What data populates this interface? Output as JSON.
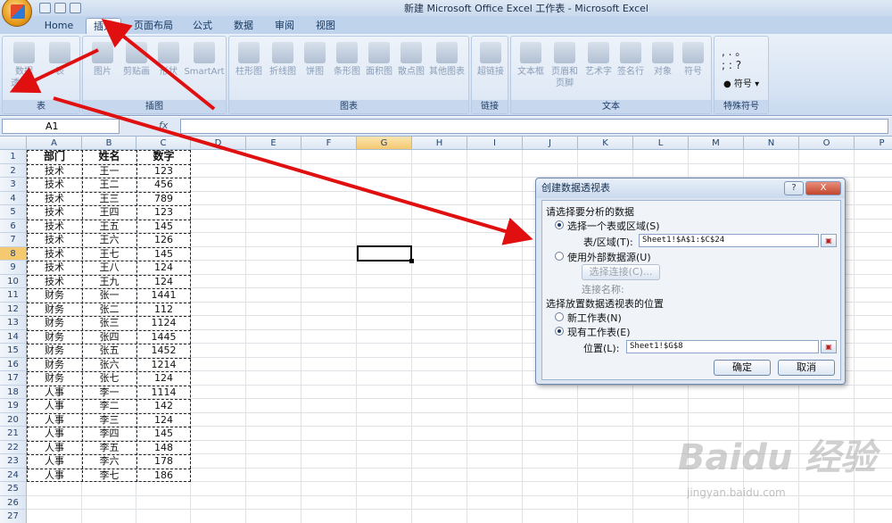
{
  "window": {
    "title": "新建 Microsoft Office Excel 工作表 - Microsoft Excel"
  },
  "tabs": [
    "Home",
    "插入",
    "页面布局",
    "公式",
    "数据",
    "审阅",
    "视图"
  ],
  "active_tab": "插入",
  "ribbon": {
    "groups": [
      "表",
      "插图",
      "图表",
      "链接",
      "文本",
      "特殊符号"
    ],
    "table": {
      "pivot1": "数据",
      "pivot2": "透视表",
      "table": "表"
    },
    "illus": [
      "图片",
      "剪贴画",
      "形状",
      "SmartArt"
    ],
    "charts": [
      "柱形图",
      "折线图",
      "饼图",
      "条形图",
      "面积图",
      "散点图",
      "其他图表"
    ],
    "links": [
      "超链接"
    ],
    "text": [
      "文本框",
      "页眉和\n页脚",
      "艺术字",
      "签名行",
      "对象",
      "符号"
    ],
    "special": {
      "symbols": "符号"
    }
  },
  "formula_bar": {
    "name_box": "A1",
    "fx": "fx",
    "content": ""
  },
  "columns": [
    "A",
    "B",
    "C",
    "D",
    "E",
    "F",
    "G",
    "H",
    "I",
    "J",
    "K",
    "L",
    "M",
    "N",
    "O",
    "P"
  ],
  "selected_col": "G",
  "selected_row": "8",
  "rows": [
    "1",
    "2",
    "3",
    "4",
    "5",
    "6",
    "7",
    "8",
    "9",
    "10",
    "11",
    "12",
    "13",
    "14",
    "15",
    "16",
    "17",
    "18",
    "19",
    "20",
    "21",
    "22",
    "23",
    "24",
    "25",
    "26",
    "27"
  ],
  "sheet": {
    "headers": [
      "部门",
      "姓名",
      "数字"
    ],
    "data": [
      [
        "技术",
        "王一",
        "123"
      ],
      [
        "技术",
        "王二",
        "456"
      ],
      [
        "技术",
        "王三",
        "789"
      ],
      [
        "技术",
        "王四",
        "123"
      ],
      [
        "技术",
        "王五",
        "145"
      ],
      [
        "技术",
        "王六",
        "126"
      ],
      [
        "技术",
        "王七",
        "145"
      ],
      [
        "技术",
        "王八",
        "124"
      ],
      [
        "技术",
        "王九",
        "124"
      ],
      [
        "财务",
        "张一",
        "1441"
      ],
      [
        "财务",
        "张二",
        "112"
      ],
      [
        "财务",
        "张三",
        "1124"
      ],
      [
        "财务",
        "张四",
        "1445"
      ],
      [
        "财务",
        "张五",
        "1452"
      ],
      [
        "财务",
        "张六",
        "1214"
      ],
      [
        "财务",
        "张七",
        "124"
      ],
      [
        "人事",
        "李一",
        "1114"
      ],
      [
        "人事",
        "李二",
        "142"
      ],
      [
        "人事",
        "李三",
        "124"
      ],
      [
        "人事",
        "李四",
        "145"
      ],
      [
        "人事",
        "李五",
        "148"
      ],
      [
        "人事",
        "李六",
        "178"
      ],
      [
        "人事",
        "李七",
        "186"
      ]
    ]
  },
  "dialog": {
    "title": "创建数据透视表",
    "help": "?",
    "close": "X",
    "section1": "请选择要分析的数据",
    "opt_select": "选择一个表或区域(S)",
    "range_label": "表/区域(T):",
    "range_value": "Sheet1!$A$1:$C$24",
    "opt_external": "使用外部数据源(U)",
    "choose_conn": "选择连接(C)...",
    "conn_name": "连接名称:",
    "section2": "选择放置数据透视表的位置",
    "opt_new": "新工作表(N)",
    "opt_existing": "现有工作表(E)",
    "location_label": "位置(L):",
    "location_value": "Sheet1!$G$8",
    "ok": "确定",
    "cancel": "取消"
  },
  "watermark": {
    "logo": "Baidu 经验",
    "url": "jingyan.baidu.com"
  }
}
